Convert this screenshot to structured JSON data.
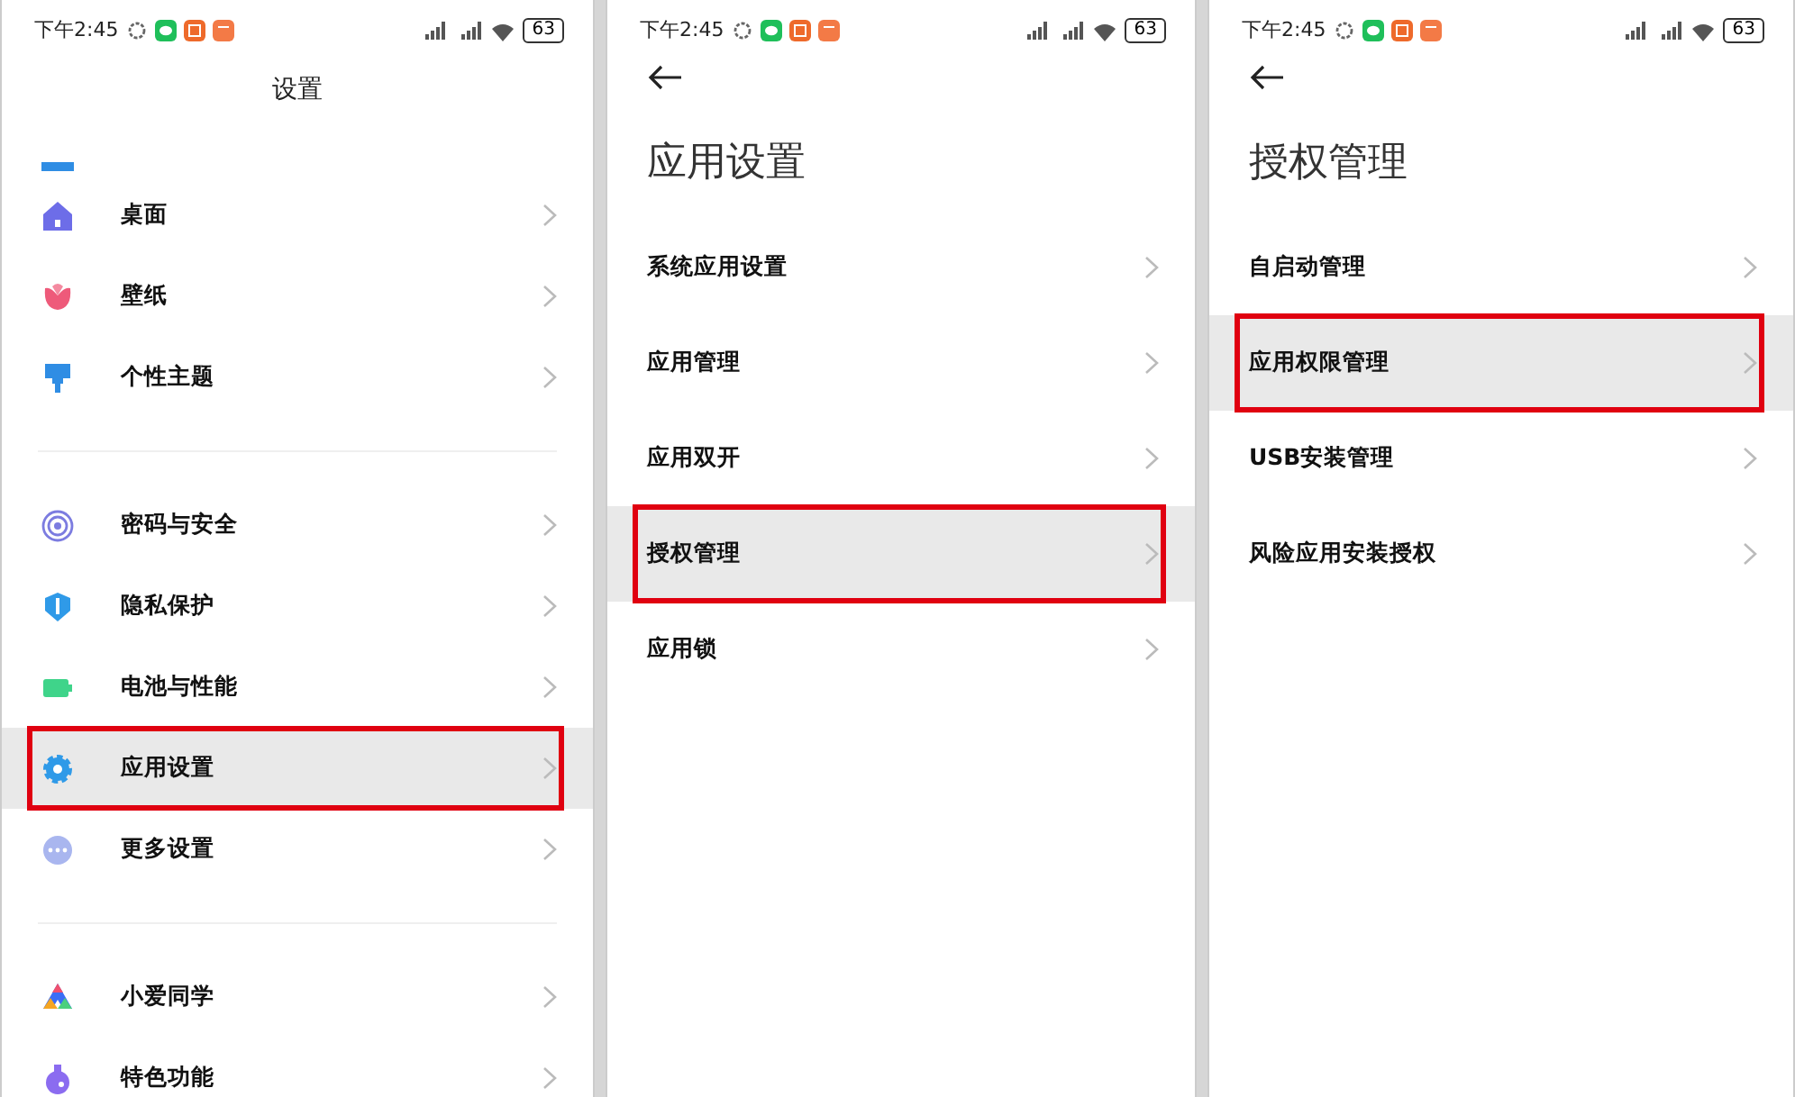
{
  "screens": [
    {
      "status_bar": {
        "time": "下午2:45",
        "battery": "63"
      },
      "header": {
        "kind": "centered",
        "title": "设置"
      },
      "groups": [
        [
          {
            "label": "桌面",
            "kind": "home",
            "selected": false
          },
          {
            "label": "壁纸",
            "kind": "flower",
            "selected": false
          },
          {
            "label": "个性主题",
            "kind": "brush",
            "selected": false
          }
        ],
        [
          {
            "label": "密码与安全",
            "kind": "target",
            "selected": false
          },
          {
            "label": "隐私保护",
            "kind": "shield",
            "selected": false
          },
          {
            "label": "电池与性能",
            "kind": "battery",
            "selected": false
          },
          {
            "label": "应用设置",
            "kind": "gear",
            "selected": true
          },
          {
            "label": "更多设置",
            "kind": "dots",
            "selected": false
          }
        ],
        [
          {
            "label": "小爱同学",
            "kind": "assistant",
            "selected": false
          },
          {
            "label": "特色功能",
            "kind": "flask",
            "selected": false
          }
        ]
      ]
    },
    {
      "status_bar": {
        "time": "下午2:45",
        "battery": "63"
      },
      "header": {
        "kind": "large",
        "title": "应用设置"
      },
      "groups": [
        [
          {
            "label": "系统应用设置",
            "kind": "text",
            "selected": false
          },
          {
            "label": "应用管理",
            "kind": "text",
            "selected": false
          },
          {
            "label": "应用双开",
            "kind": "text",
            "selected": false
          },
          {
            "label": "授权管理",
            "kind": "text",
            "selected": true
          },
          {
            "label": "应用锁",
            "kind": "text",
            "selected": false
          }
        ]
      ]
    },
    {
      "status_bar": {
        "time": "下午2:45",
        "battery": "63"
      },
      "header": {
        "kind": "large",
        "title": "授权管理"
      },
      "groups": [
        [
          {
            "label": "自启动管理",
            "kind": "text",
            "selected": false
          },
          {
            "label": "应用权限管理",
            "kind": "text",
            "selected": true
          },
          {
            "label": "USB安装管理",
            "kind": "text",
            "selected": false
          },
          {
            "label": "风险应用安装授权",
            "kind": "text",
            "selected": false
          }
        ]
      ]
    }
  ]
}
